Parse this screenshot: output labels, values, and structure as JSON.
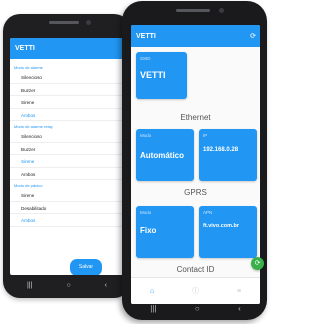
{
  "back_app": {
    "title": "VETTI",
    "sections": [
      {
        "header": "Modo de alarme",
        "options": [
          "Silencioso",
          "Buzzer",
          "Sirene",
          "Ambos"
        ],
        "selected": 3
      },
      {
        "header": "Modo de alarme relay",
        "options": [
          "Silencioso",
          "Buzzer",
          "Sirene",
          "Ambos"
        ],
        "selected": 2
      },
      {
        "header": "Modo de pânico",
        "options": [
          "Sirene",
          "Desabilitado",
          "Ambos"
        ],
        "selected": 2
      }
    ],
    "save_label": "Salvar",
    "nav": {
      "recent": "|||",
      "home": "○",
      "back": "‹"
    }
  },
  "front_app": {
    "title": "VETTI",
    "refresh_icon": "⟳",
    "ssid": {
      "label": "SSID",
      "value": "VETTI"
    },
    "ethernet": {
      "title": "Ethernet",
      "mode": {
        "label": "Modo",
        "value": "Automático"
      },
      "ip": {
        "label": "IP",
        "value": "192.168.0.28"
      }
    },
    "gprs": {
      "title": "GPRS",
      "mode": {
        "label": "Modo",
        "value": "Fixo"
      },
      "apn": {
        "label": "APN",
        "value": "ft.vivo.com.br"
      }
    },
    "contact_id_title": "Contact ID",
    "fab_icon": "⟳",
    "tabs": {
      "home": "⌂",
      "info": "ⓘ",
      "settings": "≡"
    },
    "nav": {
      "recent": "|||",
      "home": "○",
      "back": "‹"
    },
    "colors": {
      "primary": "#2196f3",
      "fab": "#39b14a"
    }
  }
}
